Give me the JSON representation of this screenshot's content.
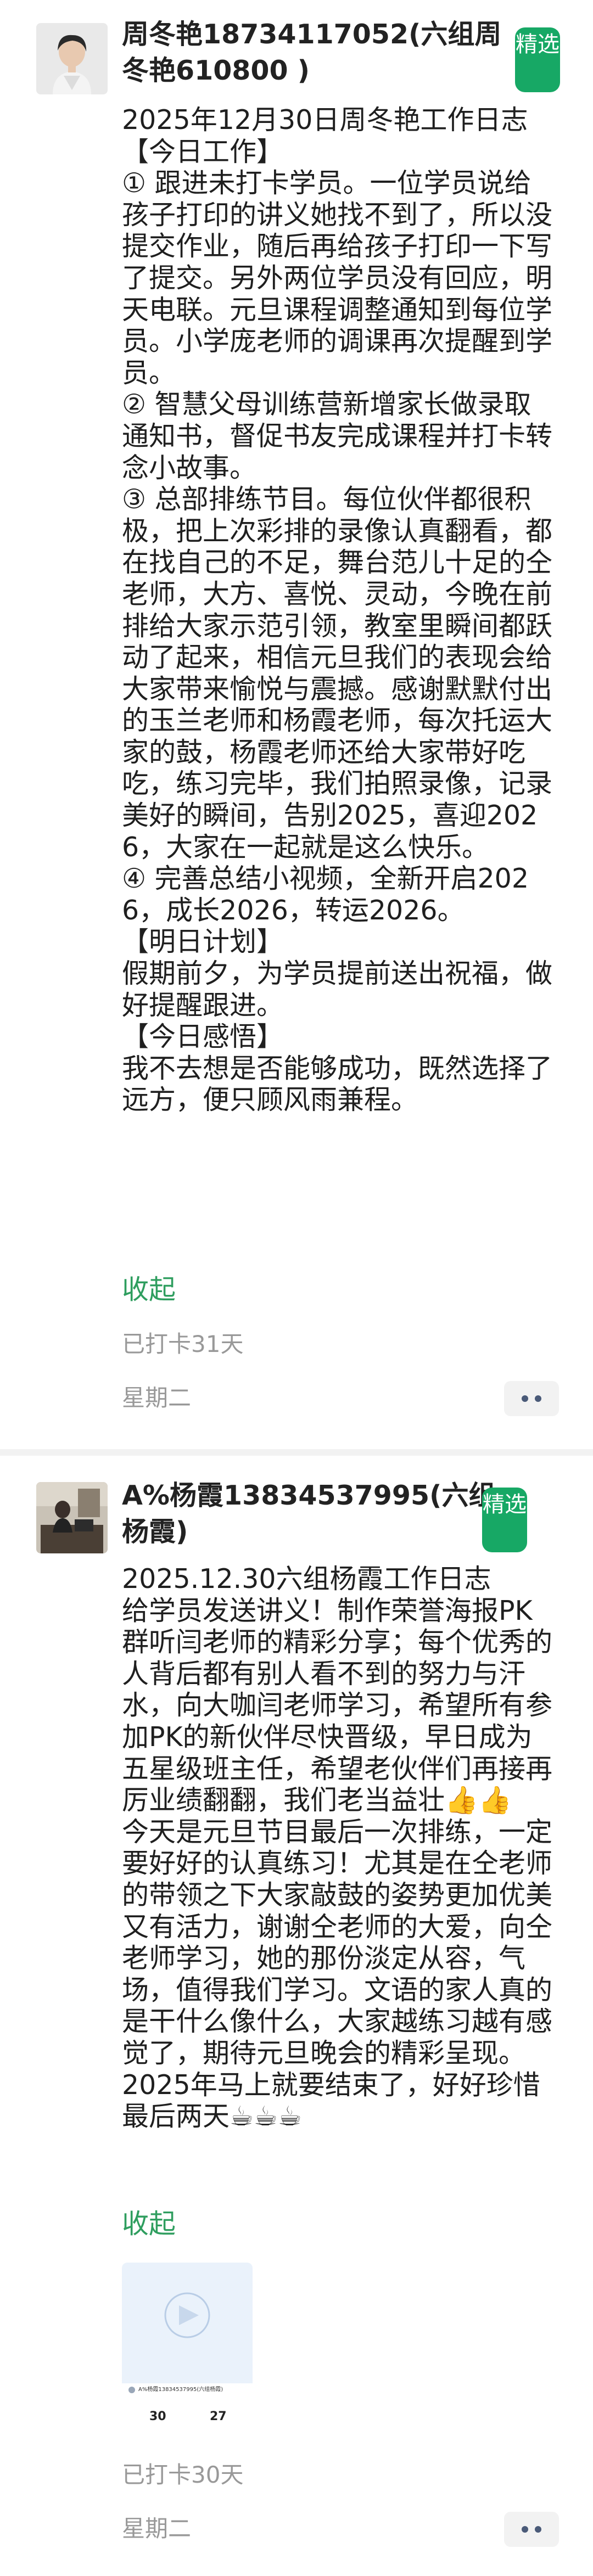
{
  "posts": [
    {
      "username_line1": "周冬艳18734117052(六组周",
      "username_line2": "冬艳610800 )",
      "badge": "精选",
      "content": "2025年12月30日周冬艳工作日志\n【今日工作】\n① 跟进未打卡学员。一位学员说给孩子打印的讲义她找不到了，所以没提交作业，随后再给孩子打印一下写了提交。另外两位学员没有回应，明天电联。元旦课程调整通知到每位学员。小学庞老师的调课再次提醒到学员。\n② 智慧父母训练营新增家长做录取通知书，督促书友完成课程并打卡转念小故事。\n③ 总部排练节目。每位伙伴都很积极，把上次彩排的录像认真翻看，都在找自己的不足，舞台范儿十足的仝老师，大方、喜悦、灵动，今晚在前排给大家示范引领，教室里瞬间都跃动了起来，相信元旦我们的表现会给大家带来愉悦与震撼。感谢默默付出的玉兰老师和杨霞老师，每次托运大家的鼓，杨霞老师还给大家带好吃吃，练习完毕，我们拍照录像，记录美好的瞬间，告别2025，喜迎2026，大家在一起就是这么快乐。\n④ 完善总结小视频，全新开启2026，成长2026，转运2026。\n【明日计划】\n假期前夕，为学员提前送出祝福，做好提醒跟进。\n【今日感悟】\n我不去想是否能够成功，既然选择了远方，便只顾风雨兼程。",
      "collapse": "收起",
      "checkin": "已打卡31天",
      "weekday": "星期二"
    },
    {
      "username_line1": "A%杨霞13834537995(六组",
      "username_line2": "杨霞)",
      "badge": "精选",
      "content": "2025.12.30六组杨霞工作日志\n给学员发送讲义！制作荣誉海报PK群听闫老师的精彩分享；每个优秀的人背后都有别人看不到的努力与汗水，向大咖闫老师学习，希望所有参加PK的新伙伴尽快晋级，早日成为五星级班主任，希望老伙伴们再接再厉业绩翻翻，我们老当益壮👍👍\n今天是元旦节目最后一次排练，一定要好好的认真练习！尤其是在仝老师的带领之下大家敲鼓的姿势更加优美又有活力，谢谢仝老师的大爱，向仝老师学习，她的那份淡定从容，气场，值得我们学习。文语的家人真的是干什么像什么，大家越练习越有感觉了，期待元旦晚会的精彩呈现。\n2025年马上就要结束了，好好珍惜最后两天☕☕☕",
      "collapse": "收起",
      "thumb": {
        "title": "A%杨霞13834537995(六组杨霞)",
        "stat1": "30",
        "stat2": "27"
      },
      "checkin": "已打卡30天",
      "weekday": "星期二"
    }
  ]
}
